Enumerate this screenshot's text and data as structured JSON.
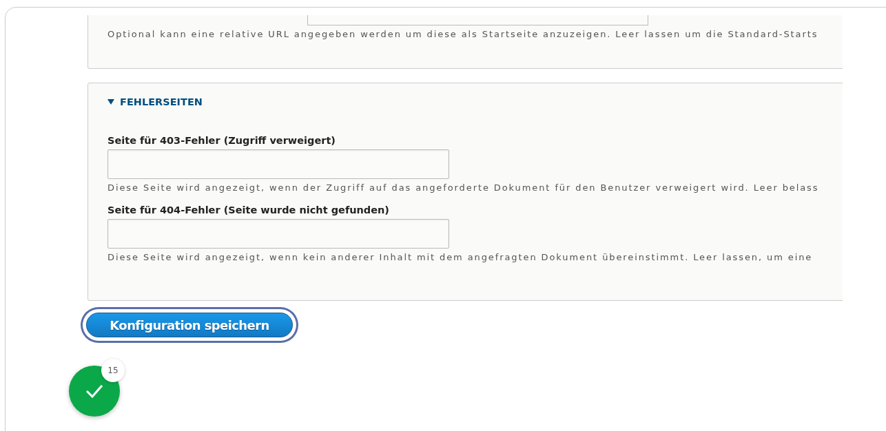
{
  "start_page": {
    "help": "Optional kann eine relative URL angegeben werden um diese als Startseite anzuzeigen. Leer lassen um die Standard-Starts"
  },
  "error_pages": {
    "title": "FEHLERSEITEN",
    "expanded": true,
    "fields": [
      {
        "label": "Seite für 403-Fehler (Zugriff verweigert)",
        "help": "Diese Seite wird angezeigt, wenn der Zugriff auf das angeforderte Dokument für den Benutzer verweigert wird. Leer belass"
      },
      {
        "label": "Seite für 404-Fehler (Seite wurde nicht gefunden)",
        "help": "Diese Seite wird angezeigt, wenn kein anderer Inhalt mit dem angefragten Dokument übereinstimmt. Leer lassen, um eine"
      }
    ]
  },
  "save_button": {
    "label": "Konfiguration speichern",
    "focused": true
  },
  "status_badge": {
    "count": "15"
  }
}
